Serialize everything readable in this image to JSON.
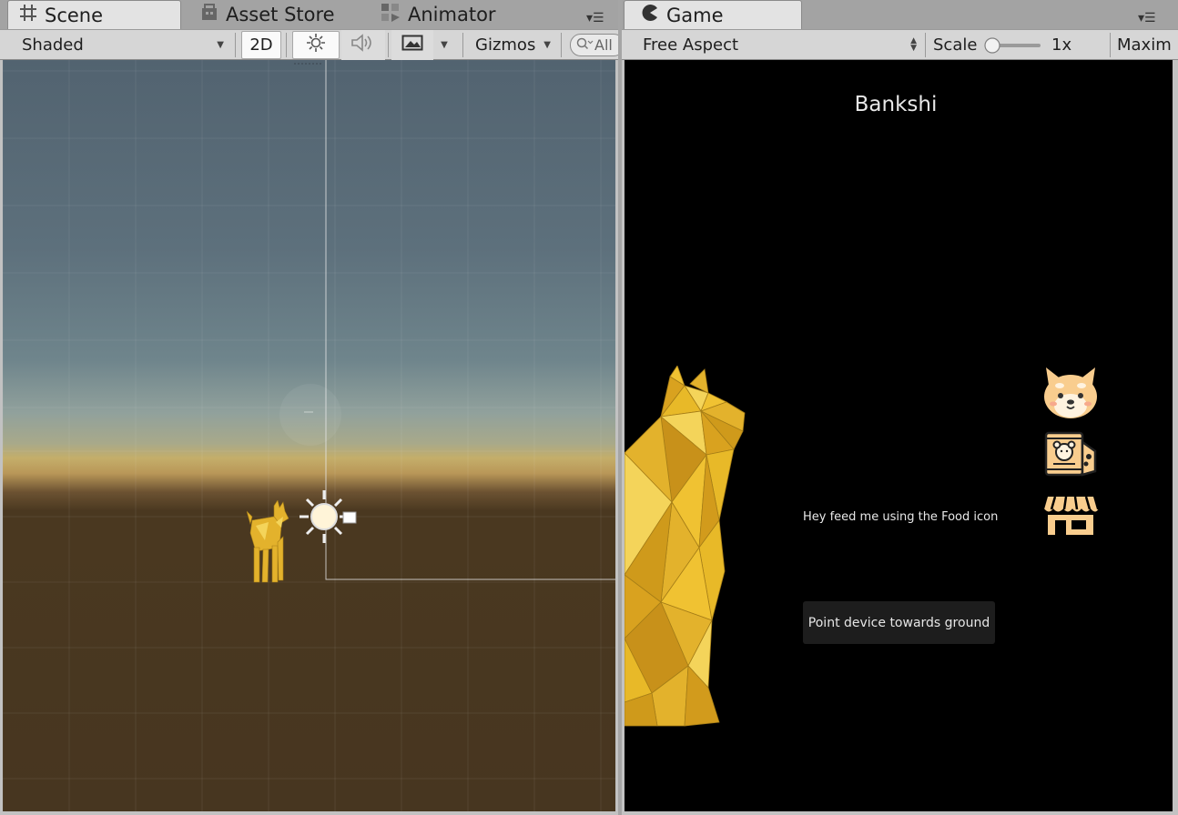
{
  "scene": {
    "tabs": [
      {
        "label": "Scene",
        "icon": "grid-icon",
        "active": true
      },
      {
        "label": "Asset Store",
        "icon": "store-icon",
        "active": false
      },
      {
        "label": "Animator",
        "icon": "animator-icon",
        "active": false
      }
    ],
    "toolbar": {
      "shading_mode": "Shaded",
      "mode_2d_label": "2D",
      "gizmos_label": "Gizmos",
      "search_placeholder": "All"
    }
  },
  "game": {
    "tab": {
      "label": "Game",
      "icon": "pacman-icon",
      "active": true
    },
    "toolbar": {
      "aspect": "Free Aspect",
      "scale_label": "Scale",
      "scale_value": "1x",
      "maximize_label": "Maxim"
    },
    "view": {
      "title": "Bankshi",
      "message": "Hey feed me using the Food icon",
      "prompt": "Point device towards ground",
      "icons": [
        "shiba-face-icon",
        "food-bag-icon",
        "shop-icon"
      ]
    }
  },
  "colors": {
    "accent_gold": "#e3b22c",
    "icon_peach": "#f9cd8e",
    "sky_top": "#526370",
    "ground": "#473620"
  }
}
